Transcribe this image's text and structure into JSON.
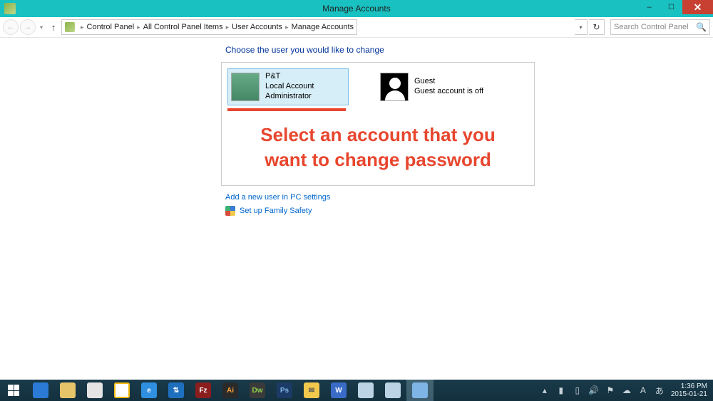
{
  "window": {
    "title": "Manage Accounts",
    "controls": {
      "min": "–",
      "max": "☐",
      "close": "✕"
    }
  },
  "nav": {
    "back": "←",
    "forward": "→",
    "up": "↑",
    "refresh": "↻",
    "breadcrumb": [
      "Control Panel",
      "All Control Panel Items",
      "User Accounts",
      "Manage Accounts"
    ],
    "search_placeholder": "Search Control Panel"
  },
  "page": {
    "heading": "Choose the user you would like to change",
    "accounts": [
      {
        "name": "P&T",
        "line2": "Local Account",
        "line3": "Administrator",
        "selected": true
      },
      {
        "name": "Guest",
        "line2": "Guest account is off",
        "line3": "",
        "selected": false
      }
    ],
    "annotation_line1": "Select an account that you",
    "annotation_line2": "want to change password",
    "link_add": "Add a new user in PC settings",
    "link_family": "Set up Family Safety"
  },
  "taskbar": {
    "icons": [
      {
        "bg": "#2b7bd6",
        "txt": ""
      },
      {
        "bg": "#e6c46a",
        "txt": ""
      },
      {
        "bg": "#e4e4e4",
        "txt": ""
      },
      {
        "bg": "#fff",
        "txt": "",
        "ring": "#f2b90f"
      },
      {
        "bg": "#2f8fe0",
        "txt": "e"
      },
      {
        "bg": "#1f6fbf",
        "txt": "⇅"
      },
      {
        "bg": "#8a1d1d",
        "txt": "Fz"
      },
      {
        "bg": "#2a2a2a",
        "txt": "Ai",
        "c": "#f7a23b"
      },
      {
        "bg": "#3a3a3a",
        "txt": "Dw",
        "c": "#8fd14f"
      },
      {
        "bg": "#1b3b66",
        "txt": "Ps",
        "c": "#7fb5e6"
      },
      {
        "bg": "#f2c94c",
        "txt": "✉",
        "c": "#555"
      },
      {
        "bg": "#3a6cc7",
        "txt": "W"
      },
      {
        "bg": "#bcd3e6",
        "txt": ""
      },
      {
        "bg": "#bcd3e6",
        "txt": ""
      },
      {
        "bg": "#7fb5e6",
        "txt": "",
        "active": true
      }
    ],
    "clock_time": "1:36 PM",
    "clock_date": "2015-01-21"
  }
}
